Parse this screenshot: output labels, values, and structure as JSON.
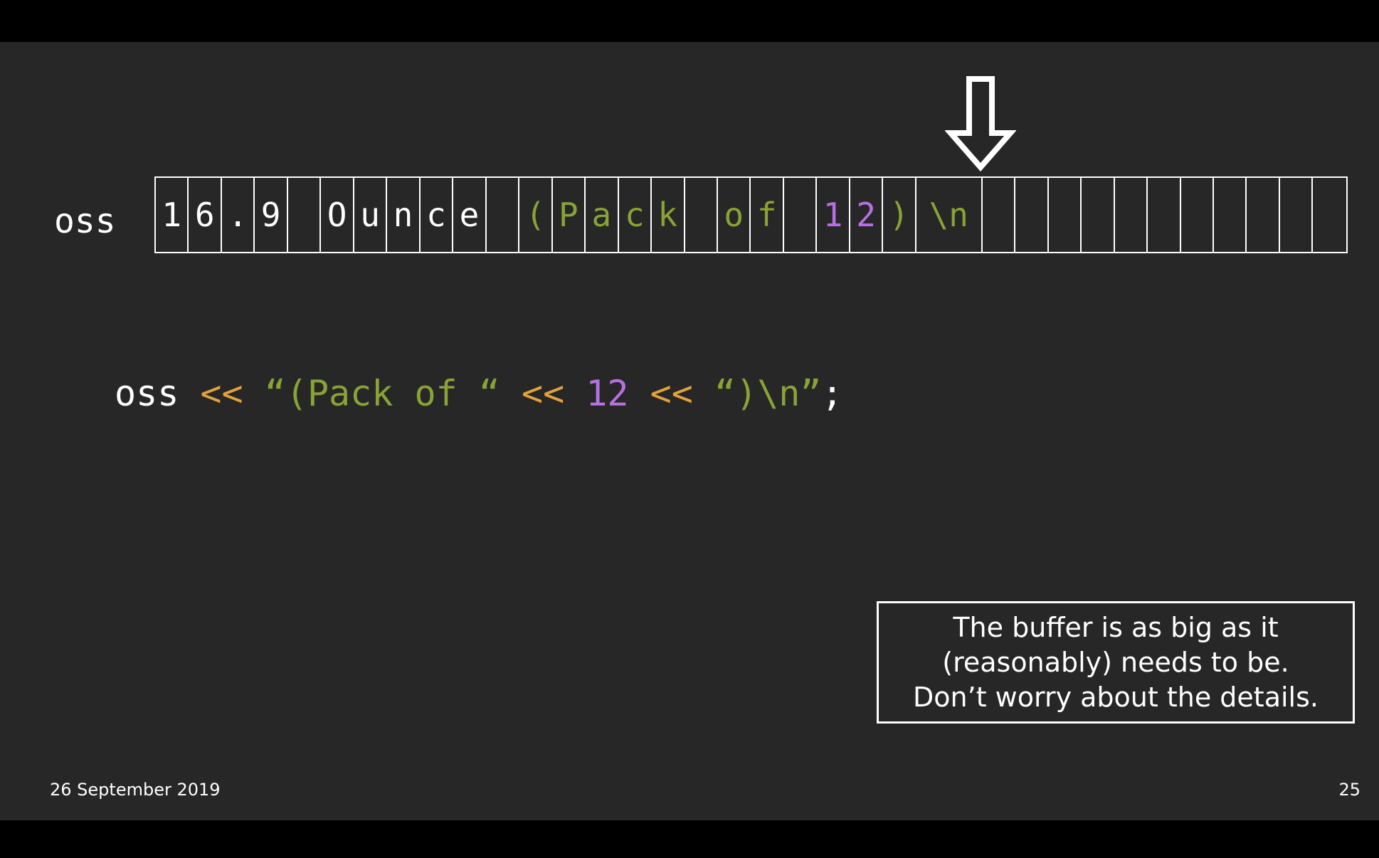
{
  "colors": {
    "background": "#272727",
    "letterbox": "#000000",
    "text": "#ffffff",
    "operator": "#e2a23b",
    "string": "#8aa236",
    "number": "#b671e0"
  },
  "buffer": {
    "label": "oss",
    "cells": [
      {
        "text": "1",
        "kind": "text"
      },
      {
        "text": "6",
        "kind": "text"
      },
      {
        "text": ".",
        "kind": "text"
      },
      {
        "text": "9",
        "kind": "text"
      },
      {
        "text": "",
        "kind": "text"
      },
      {
        "text": "O",
        "kind": "text"
      },
      {
        "text": "u",
        "kind": "text"
      },
      {
        "text": "n",
        "kind": "text"
      },
      {
        "text": "c",
        "kind": "text"
      },
      {
        "text": "e",
        "kind": "text"
      },
      {
        "text": "",
        "kind": "text"
      },
      {
        "text": "(",
        "kind": "string"
      },
      {
        "text": "P",
        "kind": "string"
      },
      {
        "text": "a",
        "kind": "string"
      },
      {
        "text": "c",
        "kind": "string"
      },
      {
        "text": "k",
        "kind": "string"
      },
      {
        "text": "",
        "kind": "string"
      },
      {
        "text": "o",
        "kind": "string"
      },
      {
        "text": "f",
        "kind": "string"
      },
      {
        "text": "",
        "kind": "string"
      },
      {
        "text": "1",
        "kind": "number"
      },
      {
        "text": "2",
        "kind": "number"
      },
      {
        "text": ")",
        "kind": "string"
      },
      {
        "text": "\\n",
        "kind": "string",
        "wide": true
      },
      {
        "text": "",
        "kind": "empty"
      },
      {
        "text": "",
        "kind": "empty"
      },
      {
        "text": "",
        "kind": "empty"
      },
      {
        "text": "",
        "kind": "empty"
      },
      {
        "text": "",
        "kind": "empty"
      },
      {
        "text": "",
        "kind": "empty"
      },
      {
        "text": "",
        "kind": "empty"
      },
      {
        "text": "",
        "kind": "empty"
      },
      {
        "text": "",
        "kind": "empty"
      },
      {
        "text": "",
        "kind": "empty"
      },
      {
        "text": "",
        "kind": "empty"
      }
    ],
    "pointer_icon": "down-arrow-outline"
  },
  "code": {
    "tokens": [
      {
        "text": "oss ",
        "kind": "text"
      },
      {
        "text": "<<",
        "kind": "operator"
      },
      {
        "text": " ",
        "kind": "text"
      },
      {
        "text": "“(Pack of “",
        "kind": "string"
      },
      {
        "text": " ",
        "kind": "text"
      },
      {
        "text": "<<",
        "kind": "operator"
      },
      {
        "text": " ",
        "kind": "text"
      },
      {
        "text": "12",
        "kind": "number"
      },
      {
        "text": " ",
        "kind": "text"
      },
      {
        "text": "<<",
        "kind": "operator"
      },
      {
        "text": " ",
        "kind": "text"
      },
      {
        "text": "“)\\n”",
        "kind": "string"
      },
      {
        "text": ";",
        "kind": "text"
      }
    ]
  },
  "note": {
    "lines": [
      "The buffer is as big as it",
      "(reasonably) needs to be.",
      "Don’t worry about the details."
    ]
  },
  "footer": {
    "date": "26 September 2019",
    "slide_number": "25"
  }
}
